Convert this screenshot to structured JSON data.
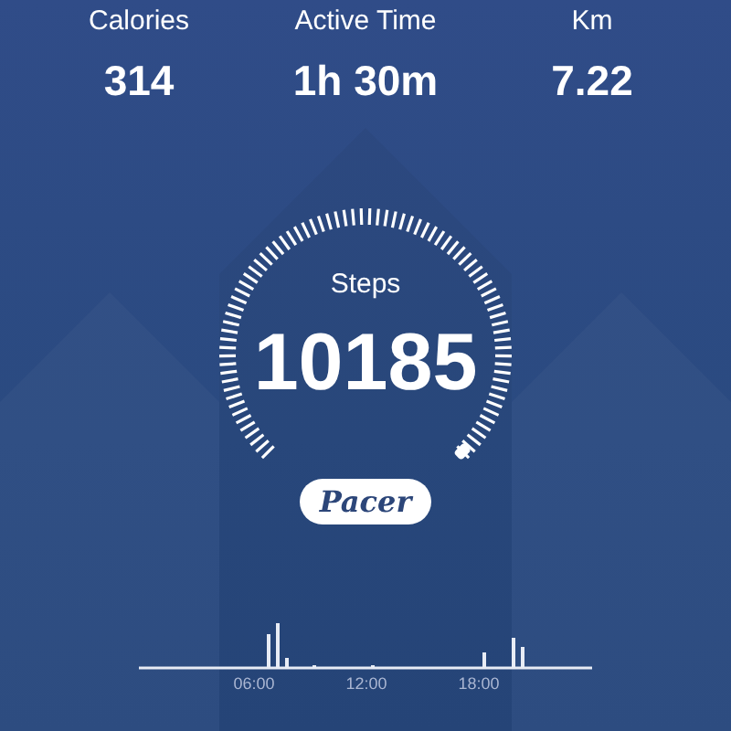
{
  "stats": [
    {
      "label": "Calories",
      "value": "314"
    },
    {
      "label": "Active Time",
      "value": "1h 30m"
    },
    {
      "label": "Km",
      "value": "7.22"
    }
  ],
  "gauge": {
    "label": "Steps",
    "value": "10185"
  },
  "brand": "Pacer",
  "activity_chart": {
    "axis_labels": [
      "06:00",
      "12:00",
      "18:00"
    ]
  }
}
